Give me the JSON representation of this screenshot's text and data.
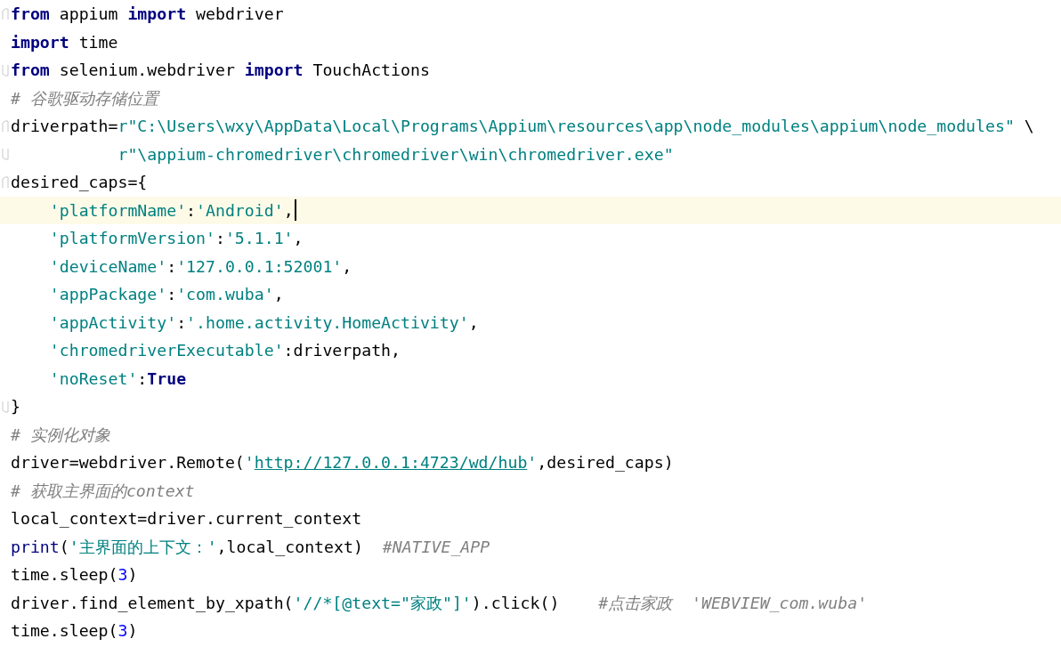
{
  "editor": {
    "lines": [
      {
        "fold_start": true,
        "fold_end": false,
        "current": false,
        "tokens": [
          {
            "kind": "keyword",
            "text": "from"
          },
          {
            "kind": "plain",
            "text": " appium "
          },
          {
            "kind": "keyword",
            "text": "import"
          },
          {
            "kind": "plain",
            "text": " webdriver"
          }
        ]
      },
      {
        "fold_start": false,
        "fold_end": false,
        "current": false,
        "tokens": [
          {
            "kind": "keyword",
            "text": "import"
          },
          {
            "kind": "plain",
            "text": " time"
          }
        ]
      },
      {
        "fold_start": false,
        "fold_end": true,
        "current": false,
        "tokens": [
          {
            "kind": "keyword",
            "text": "from"
          },
          {
            "kind": "plain",
            "text": " selenium.webdriver "
          },
          {
            "kind": "keyword",
            "text": "import"
          },
          {
            "kind": "plain",
            "text": " TouchActions"
          }
        ]
      },
      {
        "fold_start": false,
        "fold_end": false,
        "current": false,
        "tokens": [
          {
            "kind": "comment",
            "text": "# 谷歌驱动存储位置"
          }
        ]
      },
      {
        "fold_start": true,
        "fold_end": false,
        "current": false,
        "tokens": [
          {
            "kind": "plain",
            "text": "driverpath="
          },
          {
            "kind": "string",
            "text": "r\"C:\\Users\\wxy\\AppData\\Local\\Programs\\Appium\\resources\\app\\node_modules\\appium\\node_modules\""
          },
          {
            "kind": "plain",
            "text": " \\"
          }
        ]
      },
      {
        "fold_start": false,
        "fold_end": true,
        "current": false,
        "tokens": [
          {
            "kind": "string",
            "text": "           r\"\\appium-chromedriver\\chromedriver\\win\\chromedriver.exe\""
          }
        ]
      },
      {
        "fold_start": true,
        "fold_end": false,
        "current": false,
        "tokens": [
          {
            "kind": "plain",
            "text": "desired_caps={"
          }
        ]
      },
      {
        "fold_start": false,
        "fold_end": false,
        "current": true,
        "tokens": [
          {
            "kind": "string",
            "text": "    'platformName'"
          },
          {
            "kind": "plain",
            "text": ":"
          },
          {
            "kind": "string",
            "text": "'Android'"
          },
          {
            "kind": "plain",
            "text": ","
          }
        ]
      },
      {
        "fold_start": false,
        "fold_end": false,
        "current": false,
        "tokens": [
          {
            "kind": "string",
            "text": "    'platformVersion'"
          },
          {
            "kind": "plain",
            "text": ":"
          },
          {
            "kind": "string",
            "text": "'5.1.1'"
          },
          {
            "kind": "plain",
            "text": ","
          }
        ]
      },
      {
        "fold_start": false,
        "fold_end": false,
        "current": false,
        "tokens": [
          {
            "kind": "string",
            "text": "    'deviceName'"
          },
          {
            "kind": "plain",
            "text": ":"
          },
          {
            "kind": "string",
            "text": "'127.0.0.1:52001'"
          },
          {
            "kind": "plain",
            "text": ","
          }
        ]
      },
      {
        "fold_start": false,
        "fold_end": false,
        "current": false,
        "tokens": [
          {
            "kind": "string",
            "text": "    'appPackage'"
          },
          {
            "kind": "plain",
            "text": ":"
          },
          {
            "kind": "string",
            "text": "'com.wuba'"
          },
          {
            "kind": "plain",
            "text": ","
          }
        ]
      },
      {
        "fold_start": false,
        "fold_end": false,
        "current": false,
        "tokens": [
          {
            "kind": "string",
            "text": "    'appActivity'"
          },
          {
            "kind": "plain",
            "text": ":"
          },
          {
            "kind": "string",
            "text": "'.home.activity.HomeActivity'"
          },
          {
            "kind": "plain",
            "text": ","
          }
        ]
      },
      {
        "fold_start": false,
        "fold_end": false,
        "current": false,
        "tokens": [
          {
            "kind": "string",
            "text": "    'chromedriverExecutable'"
          },
          {
            "kind": "plain",
            "text": ":driverpath,"
          }
        ]
      },
      {
        "fold_start": false,
        "fold_end": false,
        "current": false,
        "tokens": [
          {
            "kind": "string",
            "text": "    'noReset'"
          },
          {
            "kind": "plain",
            "text": ":"
          },
          {
            "kind": "keyword",
            "text": "True"
          }
        ]
      },
      {
        "fold_start": false,
        "fold_end": true,
        "current": false,
        "tokens": [
          {
            "kind": "plain",
            "text": "}"
          }
        ]
      },
      {
        "fold_start": false,
        "fold_end": false,
        "current": false,
        "tokens": [
          {
            "kind": "comment",
            "text": "# 实例化对象"
          }
        ]
      },
      {
        "fold_start": false,
        "fold_end": false,
        "current": false,
        "tokens": [
          {
            "kind": "plain",
            "text": "driver=webdriver.Remote("
          },
          {
            "kind": "string",
            "text": "'"
          },
          {
            "kind": "link",
            "text": "http://127.0.0.1:4723/wd/hub"
          },
          {
            "kind": "string",
            "text": "'"
          },
          {
            "kind": "plain",
            "text": ",desired_caps)"
          }
        ]
      },
      {
        "fold_start": false,
        "fold_end": false,
        "current": false,
        "tokens": [
          {
            "kind": "comment",
            "text": "# 获取主界面的context"
          }
        ]
      },
      {
        "fold_start": false,
        "fold_end": false,
        "current": false,
        "tokens": [
          {
            "kind": "plain",
            "text": "local_context=driver.current_context"
          }
        ]
      },
      {
        "fold_start": false,
        "fold_end": false,
        "current": false,
        "tokens": [
          {
            "kind": "builtin",
            "text": "print"
          },
          {
            "kind": "plain",
            "text": "("
          },
          {
            "kind": "string",
            "text": "'主界面的上下文：'"
          },
          {
            "kind": "plain",
            "text": ",local_context)  "
          },
          {
            "kind": "comment",
            "text": "#NATIVE_APP"
          }
        ]
      },
      {
        "fold_start": false,
        "fold_end": false,
        "current": false,
        "tokens": [
          {
            "kind": "plain",
            "text": "time.sleep("
          },
          {
            "kind": "number",
            "text": "3"
          },
          {
            "kind": "plain",
            "text": ")"
          }
        ]
      },
      {
        "fold_start": false,
        "fold_end": false,
        "current": false,
        "tokens": [
          {
            "kind": "plain",
            "text": "driver.find_element_by_xpath("
          },
          {
            "kind": "string",
            "text": "'//*[@text=\"家政\"]'"
          },
          {
            "kind": "plain",
            "text": ").click()    "
          },
          {
            "kind": "comment",
            "text": "#点击家政  'WEBVIEW_com.wuba'"
          }
        ]
      },
      {
        "fold_start": false,
        "fold_end": false,
        "current": false,
        "tokens": [
          {
            "kind": "plain",
            "text": "time.sleep("
          },
          {
            "kind": "number",
            "text": "3"
          },
          {
            "kind": "plain",
            "text": ")"
          }
        ]
      }
    ]
  }
}
